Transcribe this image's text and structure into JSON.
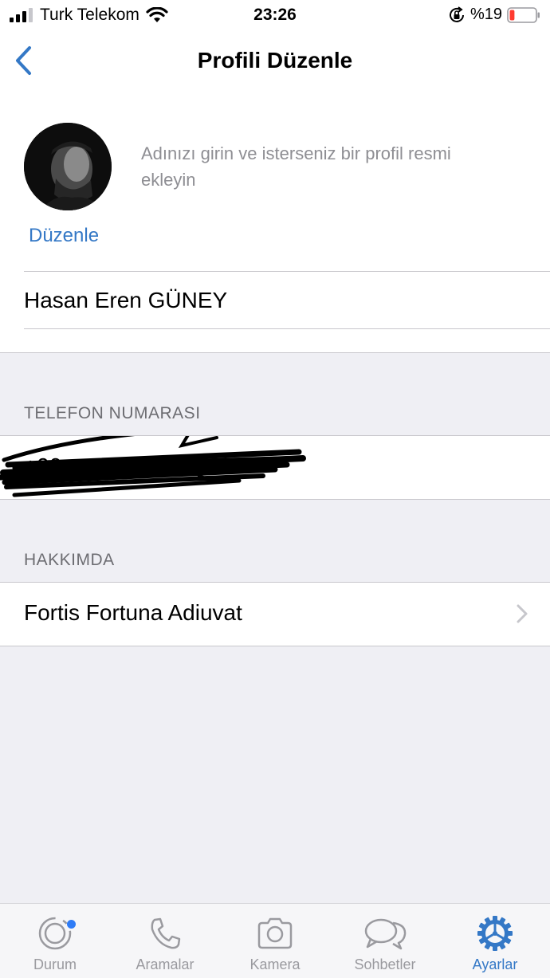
{
  "status_bar": {
    "carrier": "Turk Telekom",
    "time": "23:26",
    "battery": "%19",
    "battery_level": 0.19,
    "battery_color": "#ff3b30"
  },
  "nav": {
    "title": "Profili Düzenle",
    "back_icon": "chevron-left-icon"
  },
  "profile": {
    "hint": "Adınızı girin ve isterseniz bir profil resmi ekleyin",
    "edit_label": "Düzenle",
    "name": "Hasan Eren GÜNEY"
  },
  "phone": {
    "header": "TELEFON NUMARASI",
    "value": "+90"
  },
  "about": {
    "header": "HAKKIMDA",
    "value": "Fortis Fortuna Adiuvat"
  },
  "tabs": [
    {
      "label": "Durum",
      "icon": "status-icon",
      "active": false
    },
    {
      "label": "Aramalar",
      "icon": "phone-icon",
      "active": false
    },
    {
      "label": "Kamera",
      "icon": "camera-icon",
      "active": false
    },
    {
      "label": "Sohbetler",
      "icon": "chats-icon",
      "active": false
    },
    {
      "label": "Ayarlar",
      "icon": "settings-icon",
      "active": true
    }
  ],
  "colors": {
    "accent": "#3478c6",
    "inactive": "#9a9a9f",
    "background": "#efeff4"
  }
}
